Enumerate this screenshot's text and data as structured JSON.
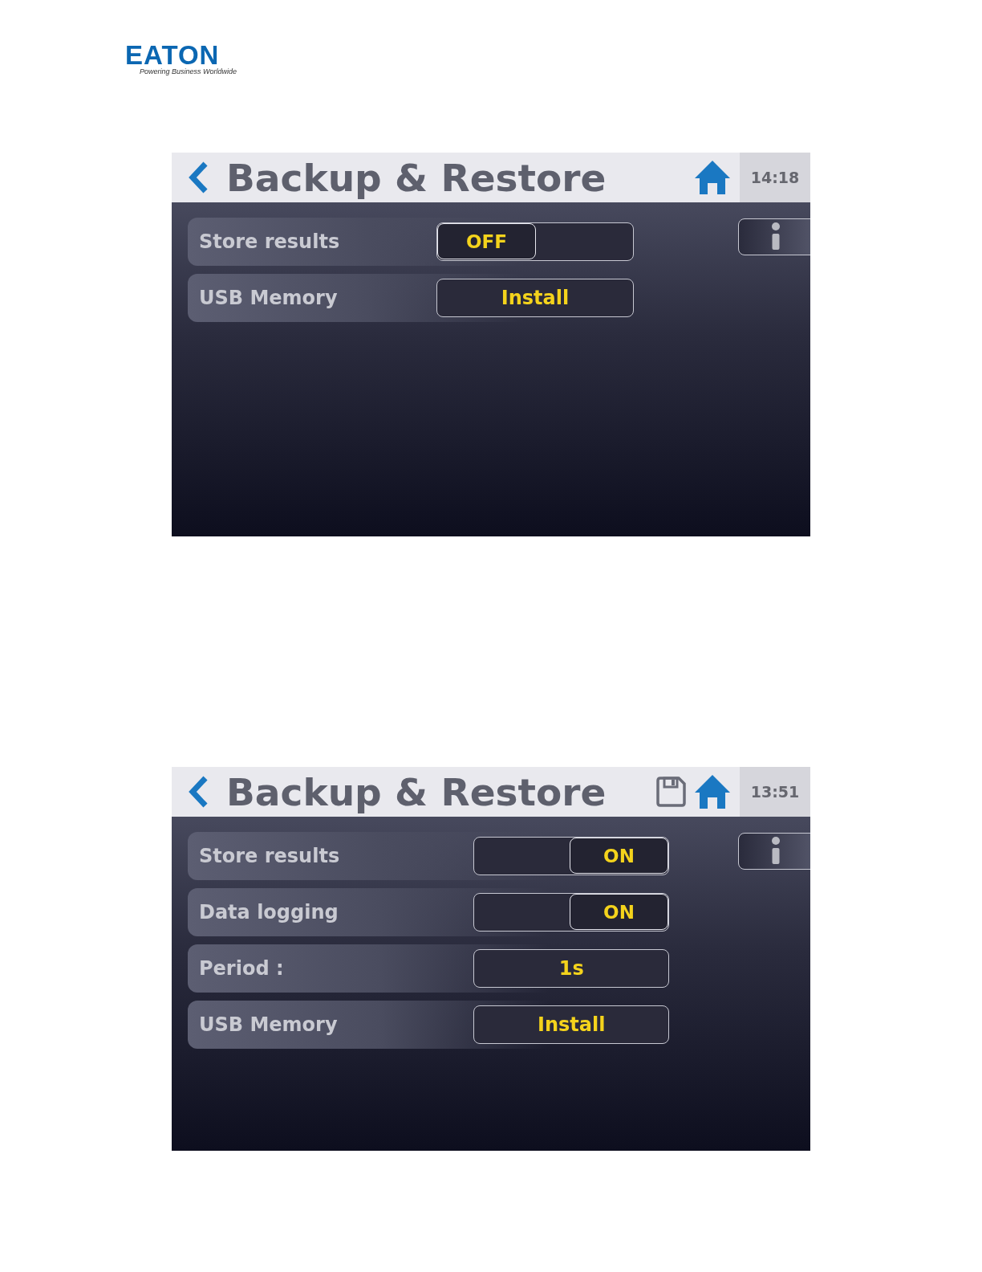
{
  "logo": {
    "name": "EATON",
    "tagline": "Powering Business Worldwide"
  },
  "screens": [
    {
      "title": "Backup & Restore",
      "save_icon": false,
      "time": "14:18",
      "rows": [
        {
          "kind": "toggle",
          "label": "Store results",
          "on": false,
          "value": "OFF"
        },
        {
          "kind": "value",
          "label": "USB Memory",
          "value": "Install"
        }
      ]
    },
    {
      "title": "Backup & Restore",
      "save_icon": true,
      "time": "13:51",
      "rows": [
        {
          "kind": "toggle",
          "label": "Store results",
          "on": true,
          "value": "ON"
        },
        {
          "kind": "toggle",
          "label": "Data logging",
          "on": true,
          "value": "ON"
        },
        {
          "kind": "value",
          "label": "Period :",
          "value": "1s"
        },
        {
          "kind": "value",
          "label": "USB Memory",
          "value": "Install"
        }
      ]
    }
  ]
}
